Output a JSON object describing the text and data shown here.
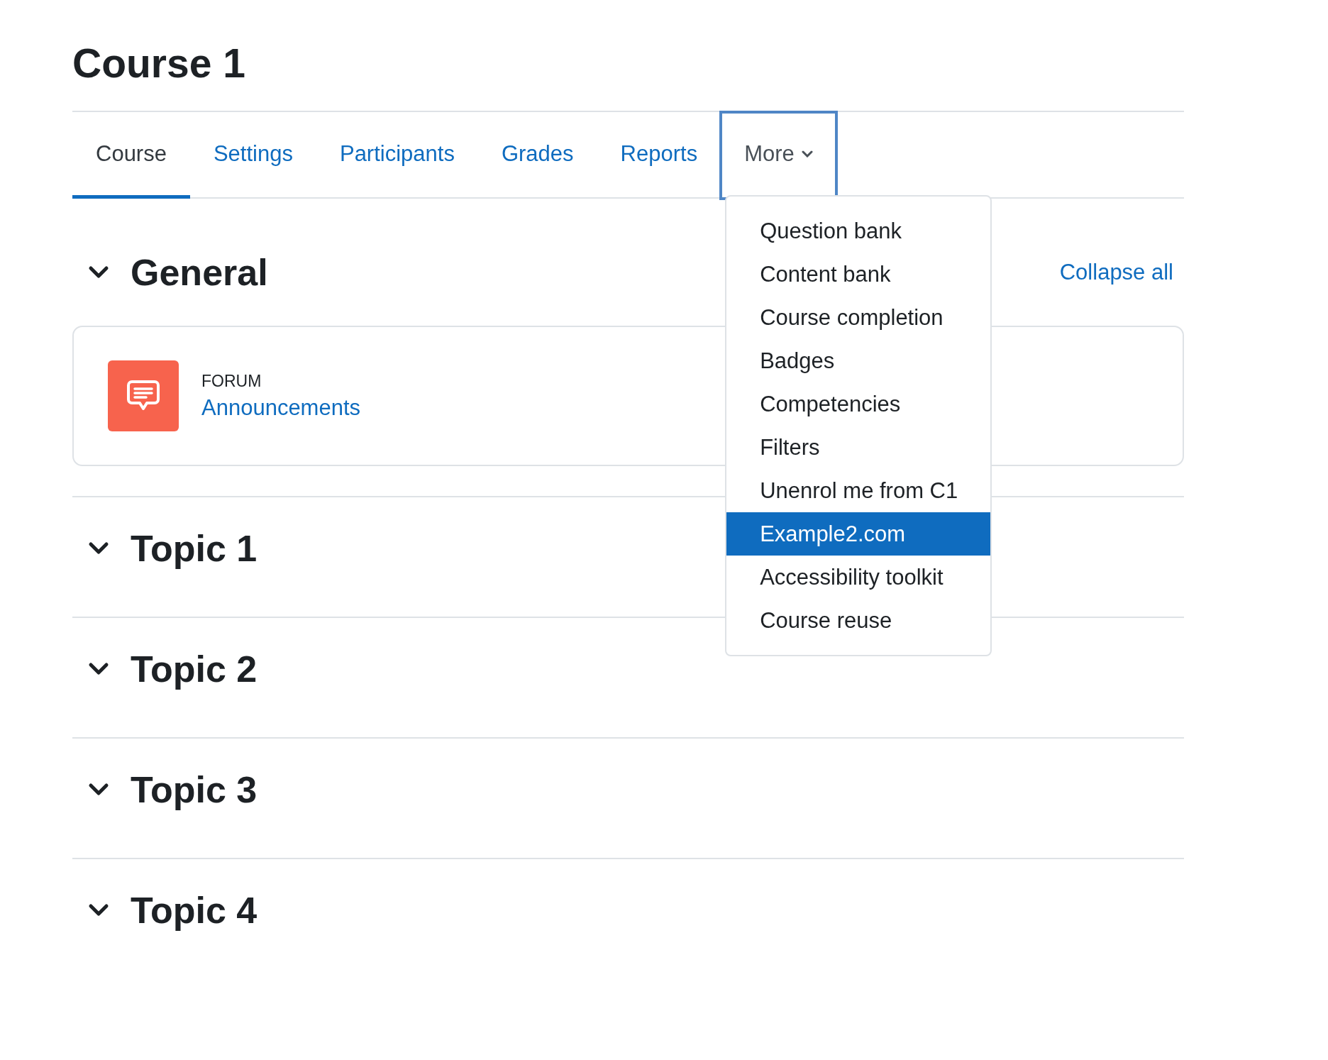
{
  "page": {
    "title": "Course 1"
  },
  "tabs": [
    {
      "label": "Course",
      "kind": "link",
      "selected": true
    },
    {
      "label": "Settings",
      "kind": "link",
      "selected": false
    },
    {
      "label": "Participants",
      "kind": "link",
      "selected": false
    },
    {
      "label": "Grades",
      "kind": "link",
      "selected": false
    },
    {
      "label": "Reports",
      "kind": "link",
      "selected": false
    },
    {
      "label": "More",
      "kind": "dropdown",
      "expanded": true
    }
  ],
  "more_menu": [
    {
      "label": "Question bank",
      "selected": false
    },
    {
      "label": "Content bank",
      "selected": false
    },
    {
      "label": "Course completion",
      "selected": false
    },
    {
      "label": "Badges",
      "selected": false
    },
    {
      "label": "Competencies",
      "selected": false
    },
    {
      "label": "Filters",
      "selected": false
    },
    {
      "label": "Unenrol me from C1",
      "selected": false
    },
    {
      "label": "Example2.com",
      "selected": true
    },
    {
      "label": "Accessibility toolkit",
      "selected": false
    },
    {
      "label": "Course reuse",
      "selected": false
    }
  ],
  "collapse_all": "Collapse all",
  "sections": [
    {
      "title": "General",
      "expanded": true,
      "activities": [
        {
          "type": "FORUM",
          "name": "Announcements"
        }
      ]
    },
    {
      "title": "Topic 1",
      "expanded": true
    },
    {
      "title": "Topic 2",
      "expanded": true
    },
    {
      "title": "Topic 3",
      "expanded": true
    },
    {
      "title": "Topic 4",
      "expanded": true
    }
  ]
}
